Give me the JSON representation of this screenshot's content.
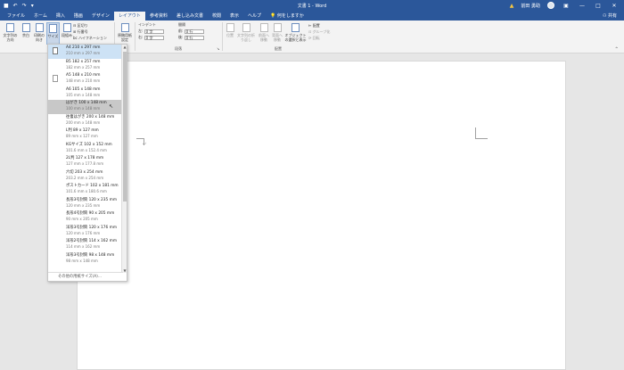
{
  "titlebar": {
    "doc_title": "文書 1 - Word",
    "user_name": "前田 勇助",
    "qat": [
      "save-icon",
      "undo-icon",
      "redo-icon",
      "customize-icon"
    ]
  },
  "tabs": [
    "ファイル",
    "ホーム",
    "挿入",
    "描画",
    "デザイン",
    "レイアウト",
    "参考資料",
    "差し込み文書",
    "校閲",
    "表示",
    "ヘルプ",
    "何をしますか"
  ],
  "active_tab": "レイアウト",
  "share_label": "共有",
  "ribbon": {
    "text_direction": "文字列の方向",
    "margins": "余白",
    "orientation": "印刷の向き",
    "size": "サイズ",
    "columns": "段組み",
    "breaks": "区切り",
    "line_numbers": "行番号",
    "hyphenation": "ハイフネーション",
    "page_setup": "原稿用紙設定",
    "indent_header": "インデント",
    "spacing_header": "間隔",
    "indent_left_label": "左:",
    "indent_left_value": "0 字",
    "indent_right_label": "右:",
    "indent_right_value": "0 字",
    "spacing_before_label": "前:",
    "spacing_before_value": "0 行",
    "spacing_after_label": "後:",
    "spacing_after_value": "0 行",
    "paragraph_group": "段落",
    "position": "位置",
    "wrap_text": "文字列の折り返し",
    "bring_forward": "前面へ移動",
    "send_backward": "背面へ移動",
    "selection_pane": "オブジェクトの選択と表示",
    "align": "配置",
    "group": "グループ化",
    "rotate": "回転",
    "arrange_group": "配置"
  },
  "paper_sizes": [
    {
      "name": "A4 210 x 297 mm",
      "sub": "210 mm x 297 mm"
    },
    {
      "name": "B5 182 x 257 mm",
      "sub": "182 mm x 257 mm"
    },
    {
      "name": "A5 148 x 210 mm",
      "sub": "148 mm x 210 mm"
    },
    {
      "name": "A6 105 x 148 mm",
      "sub": "105 mm x 148 mm"
    },
    {
      "name": "はがき 100 x 148 mm",
      "sub": "100 mm x 148 mm"
    },
    {
      "name": "往復はがき 200 x 148 mm",
      "sub": "200 mm x 148 mm"
    },
    {
      "name": "L判 89 x 127 mm",
      "sub": "89 mm x 127 mm"
    },
    {
      "name": "KGサイズ 102 x 152 mm",
      "sub": "101.6 mm x 152.4 mm"
    },
    {
      "name": "2L判 127 x 178 mm",
      "sub": "127 mm x 177.8 mm"
    },
    {
      "name": "六切 203 x 254 mm",
      "sub": "203.2 mm x 254 mm"
    },
    {
      "name": "ポストカード 102 x 181 mm",
      "sub": "101.6 mm x 180.6 mm"
    },
    {
      "name": "長形3号封筒 120 x 235 mm",
      "sub": "120 mm x 235 mm"
    },
    {
      "name": "長形4号封筒 90 x 205 mm",
      "sub": "90 mm x 205 mm"
    },
    {
      "name": "洋形3号封筒 120 x 176 mm",
      "sub": "120 mm x 176 mm"
    },
    {
      "name": "洋形2号封筒 114 x 162 mm",
      "sub": "114 mm x 162 mm"
    },
    {
      "name": "洋形3号封筒 98 x 148 mm",
      "sub": "98 mm x 148 mm"
    }
  ],
  "more_sizes": "その他の用紙サイズ(A)...",
  "paragraph_mark": "↵"
}
